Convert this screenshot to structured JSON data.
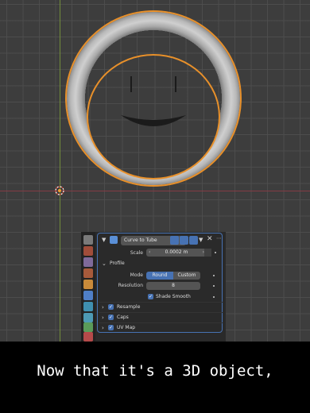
{
  "modifier": {
    "name": "Curve to Tube",
    "scale_label": "Scale",
    "scale_value": "0.0002 m",
    "profile_label": "Profile",
    "mode_label": "Mode",
    "mode_options": [
      "Round",
      "Custom"
    ],
    "mode_selected": "Round",
    "resolution_label": "Resolution",
    "resolution_value": "8",
    "shade_smooth_label": "Shade Smooth",
    "shade_smooth_checked": true,
    "subpanels": [
      {
        "label": "Resample",
        "checked": true
      },
      {
        "label": "Caps",
        "checked": true
      },
      {
        "label": "UV Map",
        "checked": true
      }
    ]
  },
  "caption": "Now that it's a 3D object,",
  "colors": {
    "selection_outline": "#e8902a",
    "accent": "#4772b3",
    "axis_x": "#8a3b45",
    "axis_y": "#7a9a3a"
  },
  "icons": {
    "origin": "origin-cursor-icon",
    "tabs": [
      "tool-icon",
      "render-icon",
      "output-icon",
      "scene-icon",
      "object-icon",
      "modifier-icon",
      "particles-icon",
      "physics-icon",
      "constraints-icon",
      "data-icon"
    ]
  }
}
